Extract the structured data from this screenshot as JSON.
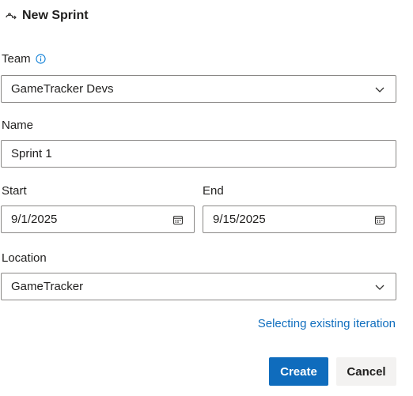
{
  "header": {
    "icon": "sprint-icon",
    "title": "New Sprint"
  },
  "team": {
    "label": "Team",
    "info_icon": "info-icon",
    "value": "GameTracker Devs",
    "dropdown_icon": "chevron-down-icon"
  },
  "name": {
    "label": "Name",
    "value": "Sprint 1"
  },
  "start": {
    "label": "Start",
    "value": "9/1/2025",
    "icon": "calendar-icon"
  },
  "end": {
    "label": "End",
    "value": "9/15/2025",
    "icon": "calendar-icon"
  },
  "location": {
    "label": "Location",
    "value": "GameTracker",
    "dropdown_icon": "chevron-down-icon"
  },
  "link_text": "Selecting existing iteration",
  "buttons": {
    "create": "Create",
    "cancel": "Cancel"
  },
  "colors": {
    "primary": "#0f6cbd",
    "link": "#106ebe",
    "info": "#0078d4",
    "border": "#8a8886"
  }
}
